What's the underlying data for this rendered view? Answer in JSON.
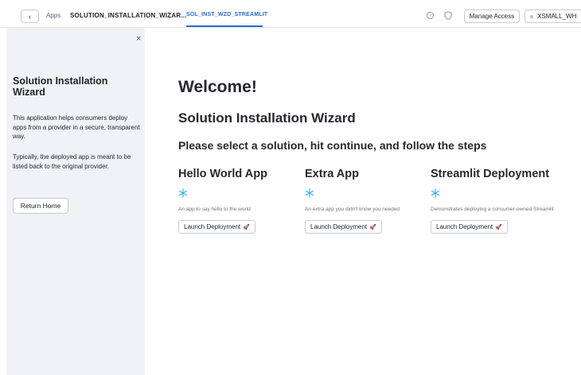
{
  "topbar": {
    "back_glyph": "‹",
    "apps_label": "Apps",
    "app_name": "SOLUTION_INSTALLATION_WIZAR...",
    "active_tab": "SOL_INST_WZD_STREAMLIT",
    "info_glyph": "i",
    "manage_access_label": "Manage Access",
    "warehouse_label": "XSMALL_WH"
  },
  "sidebar": {
    "close_glyph": "×",
    "title": "Solution Installation Wizard",
    "paragraph1": "This application helps consumers deploy apps from a provider in a secure, transparent way.",
    "paragraph2": "Typically, the deployed app is meant to be listed back to the original provider.",
    "return_label": "Return Home"
  },
  "main": {
    "welcome": "Welcome!",
    "wizard_title": "Solution Installation Wizard",
    "instruction": "Please select a solution, hit continue, and follow the steps",
    "cards": [
      {
        "title": "Hello World App",
        "description": "An app to say hello to the world",
        "button_label": "Launch Deployment",
        "button_icon": "🚀"
      },
      {
        "title": "Extra App",
        "description": "An extra app you didn't know you needed",
        "button_label": "Launch Deployment",
        "button_icon": "🚀"
      },
      {
        "title": "Streamlit Deployment",
        "description": "Demonstrates deploying a consumer-owned Streamlit",
        "button_label": "Launch Deployment",
        "button_icon": "🚀"
      }
    ]
  },
  "icons": {
    "card_icon": "snowflake-icon",
    "card_icon_color": "#29b5e8",
    "accent_color": "#2c6cc9"
  }
}
